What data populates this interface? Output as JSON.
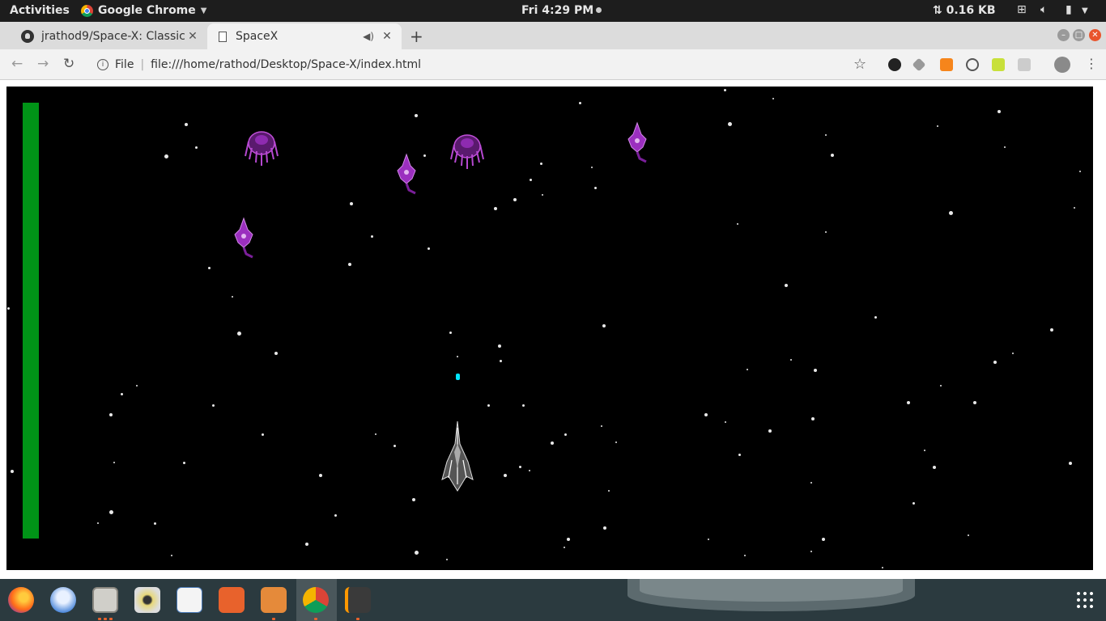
{
  "topbar": {
    "activities": "Activities",
    "app_name": "Google Chrome",
    "clock": "Fri  4:29 PM",
    "network_rate": "⇅ 0.16 KB"
  },
  "tabs": [
    {
      "title": "jrathod9/Space-X: Classic",
      "icon": "github-icon"
    },
    {
      "title": "SpaceX",
      "icon": "page-icon",
      "audio": true,
      "active": true
    }
  ],
  "toolbar": {
    "scheme_label": "File",
    "url": "file:///home/rathod/Desktop/Space-X/index.html"
  },
  "game": {
    "background": "#000000",
    "health_bar_color": "#009317",
    "bullet_color": "#00e5ff",
    "enemy_color": "#9b2fbf",
    "health_fraction": 1.0
  },
  "dock": {
    "apps": [
      "firefox-icon",
      "thunderbird-icon",
      "files-icon",
      "rhythmbox-icon",
      "document-viewer-icon",
      "software-center-icon",
      "file-roller-icon",
      "chrome-icon",
      "sublime-text-icon"
    ]
  }
}
